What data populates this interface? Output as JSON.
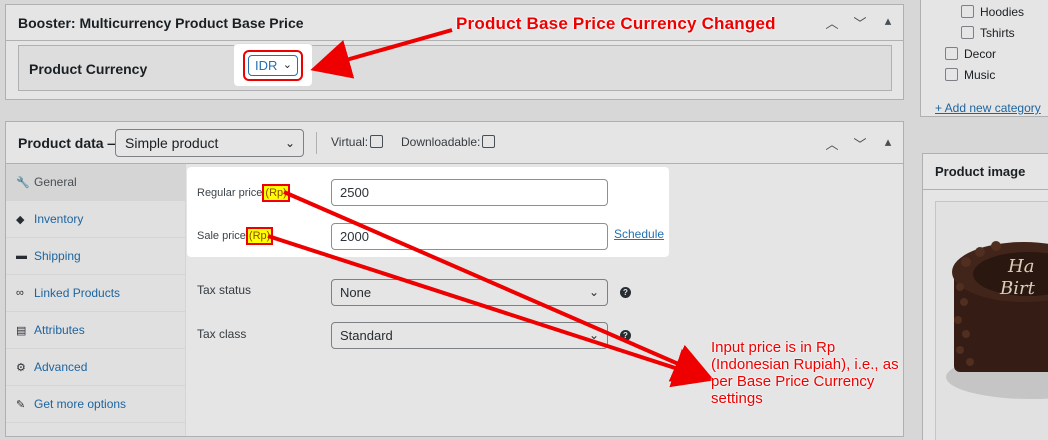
{
  "booster": {
    "title": "Booster: Multicurrency Product Base Price",
    "field_label": "Product Currency",
    "currency_value": "IDR"
  },
  "product_data": {
    "title": "Product data —",
    "product_type": "Simple product",
    "virtual_label": "Virtual:",
    "downloadable_label": "Downloadable:",
    "tabs": [
      {
        "label": "General",
        "icon": "wrench-icon"
      },
      {
        "label": "Inventory",
        "icon": "tag-icon"
      },
      {
        "label": "Shipping",
        "icon": "truck-icon"
      },
      {
        "label": "Linked Products",
        "icon": "link-icon"
      },
      {
        "label": "Attributes",
        "icon": "list-icon"
      },
      {
        "label": "Advanced",
        "icon": "gear-icon"
      },
      {
        "label": "Get more options",
        "icon": "plugin-icon"
      }
    ],
    "regular_price_label": "Regular price",
    "regular_price_currency": "(Rp)",
    "regular_price_value": "2500",
    "sale_price_label": "Sale price",
    "sale_price_currency": "(Rp)",
    "sale_price_value": "2000",
    "schedule_label": "Schedule",
    "tax_status_label": "Tax status",
    "tax_status_value": "None",
    "tax_class_label": "Tax class",
    "tax_class_value": "Standard"
  },
  "categories": {
    "items": [
      "Hoodies",
      "Tshirts",
      "Decor",
      "Music"
    ],
    "add_new": "+ Add new category"
  },
  "product_image": {
    "title": "Product image",
    "cake_text": "Happy Birthday"
  },
  "annotations": {
    "title": "Product Base Price Currency Changed",
    "note": "Input price is in Rp (Indonesian Rupiah), i.e., as per Base Price Currency settings"
  },
  "colors": {
    "accent": "#2271b1",
    "annotation": "#ee0000",
    "highlight": "#ffff00"
  }
}
